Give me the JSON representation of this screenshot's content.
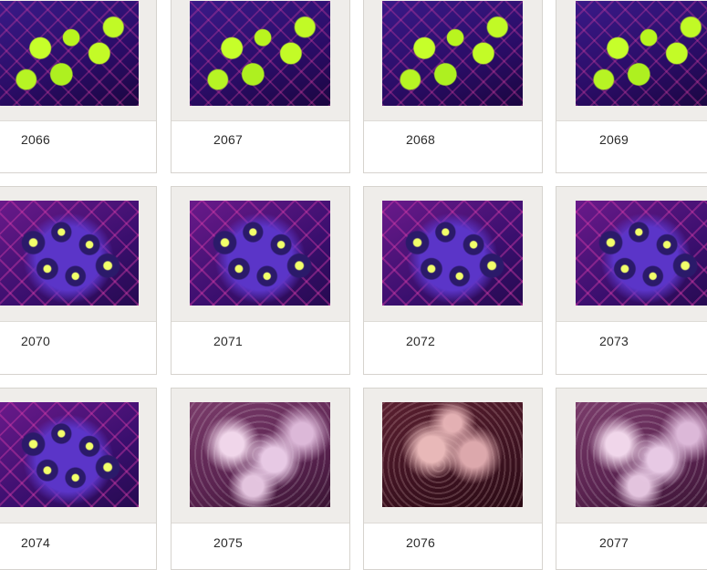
{
  "gallery": {
    "items": [
      {
        "label": "2066",
        "image_name": "coral-thumb-green"
      },
      {
        "label": "2067",
        "image_name": "coral-thumb-green"
      },
      {
        "label": "2068",
        "image_name": "coral-thumb-green"
      },
      {
        "label": "2069",
        "image_name": "coral-thumb-green"
      },
      {
        "label": "2070",
        "image_name": "coral-thumb-zoanthid"
      },
      {
        "label": "2071",
        "image_name": "coral-thumb-zoanthid"
      },
      {
        "label": "2072",
        "image_name": "coral-thumb-zoanthid"
      },
      {
        "label": "2073",
        "image_name": "coral-thumb-zoanthid"
      },
      {
        "label": "2074",
        "image_name": "coral-thumb-zoanthid"
      },
      {
        "label": "2075",
        "image_name": "coral-thumb-soft-coral"
      },
      {
        "label": "2076",
        "image_name": "coral-thumb-soft-coral"
      },
      {
        "label": "2077",
        "image_name": "coral-thumb-soft-coral"
      }
    ]
  },
  "colors": {
    "frame_bg": "#efedea",
    "card_border": "#d6d3ce",
    "caption_text": "#2b2b2b"
  }
}
